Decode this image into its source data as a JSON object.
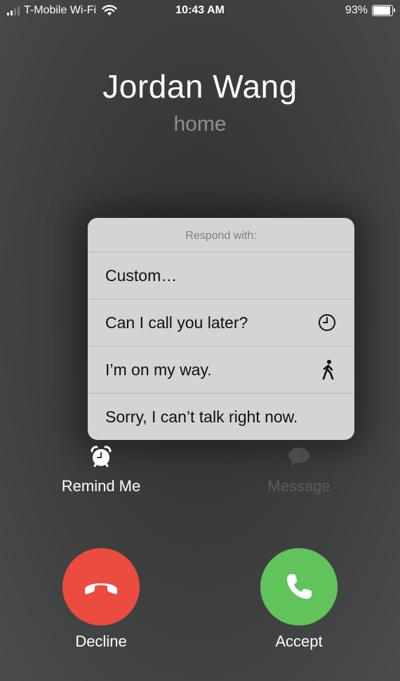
{
  "status_bar": {
    "carrier": "T-Mobile Wi-Fi",
    "time": "10:43 AM",
    "battery_percent": "93%",
    "battery_level": 0.93
  },
  "caller": {
    "name": "Jordan Wang",
    "label": "home"
  },
  "respond_sheet": {
    "title": "Respond with:",
    "items": [
      {
        "label": "Custom…",
        "icon": ""
      },
      {
        "label": "Can I call you later?",
        "icon": "clock-icon"
      },
      {
        "label": "I’m on my way.",
        "icon": "walking-person-icon"
      },
      {
        "label": "Sorry, I can’t talk right now.",
        "icon": ""
      }
    ]
  },
  "options": {
    "remind_me": "Remind Me",
    "message": "Message"
  },
  "actions": {
    "decline": "Decline",
    "accept": "Accept"
  },
  "colors": {
    "decline": "#ea4c3f",
    "accept": "#61c35b"
  }
}
